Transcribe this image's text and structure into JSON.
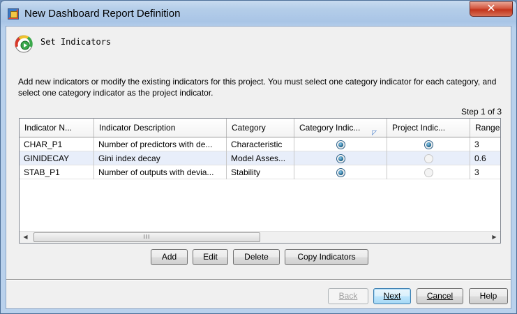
{
  "window": {
    "title": "New Dashboard Report Definition",
    "close_glyph": "✕"
  },
  "step": {
    "title": "Set Indicators",
    "instructions": "Add new indicators or modify the existing indicators for this project. You must select one category indicator for each category, and select one category indicator as the project indicator.",
    "info": "Step 1 of 3"
  },
  "table": {
    "columns": [
      "Indicator N...",
      "Indicator Description",
      "Category",
      "Category Indic...",
      "Project Indic...",
      "Range"
    ],
    "sort_glyph": "◸",
    "rows": [
      {
        "name": "CHAR_P1",
        "description": "Number of predictors with de...",
        "category": "Characteristic",
        "category_indicator": true,
        "project_indicator": true,
        "range": "3"
      },
      {
        "name": "GINIDECAY",
        "description": "Gini index decay",
        "category": "Model Asses...",
        "category_indicator": true,
        "project_indicator": false,
        "range": "0.6"
      },
      {
        "name": "STAB_P1",
        "description": "Number of outputs with devia...",
        "category": "Stability",
        "category_indicator": true,
        "project_indicator": false,
        "range": "3"
      }
    ],
    "scroll": {
      "left": "◀",
      "right": "▶",
      "thumb": "III"
    }
  },
  "actions": {
    "add": "Add",
    "edit": "Edit",
    "delete": "Delete",
    "copy": "Copy Indicators"
  },
  "footer": {
    "back": "Back",
    "next": "Next",
    "cancel": "Cancel",
    "help": "Help"
  },
  "icons": {
    "app": "dashboard-app-icon",
    "indicator": "gauge-indicator-icon"
  }
}
